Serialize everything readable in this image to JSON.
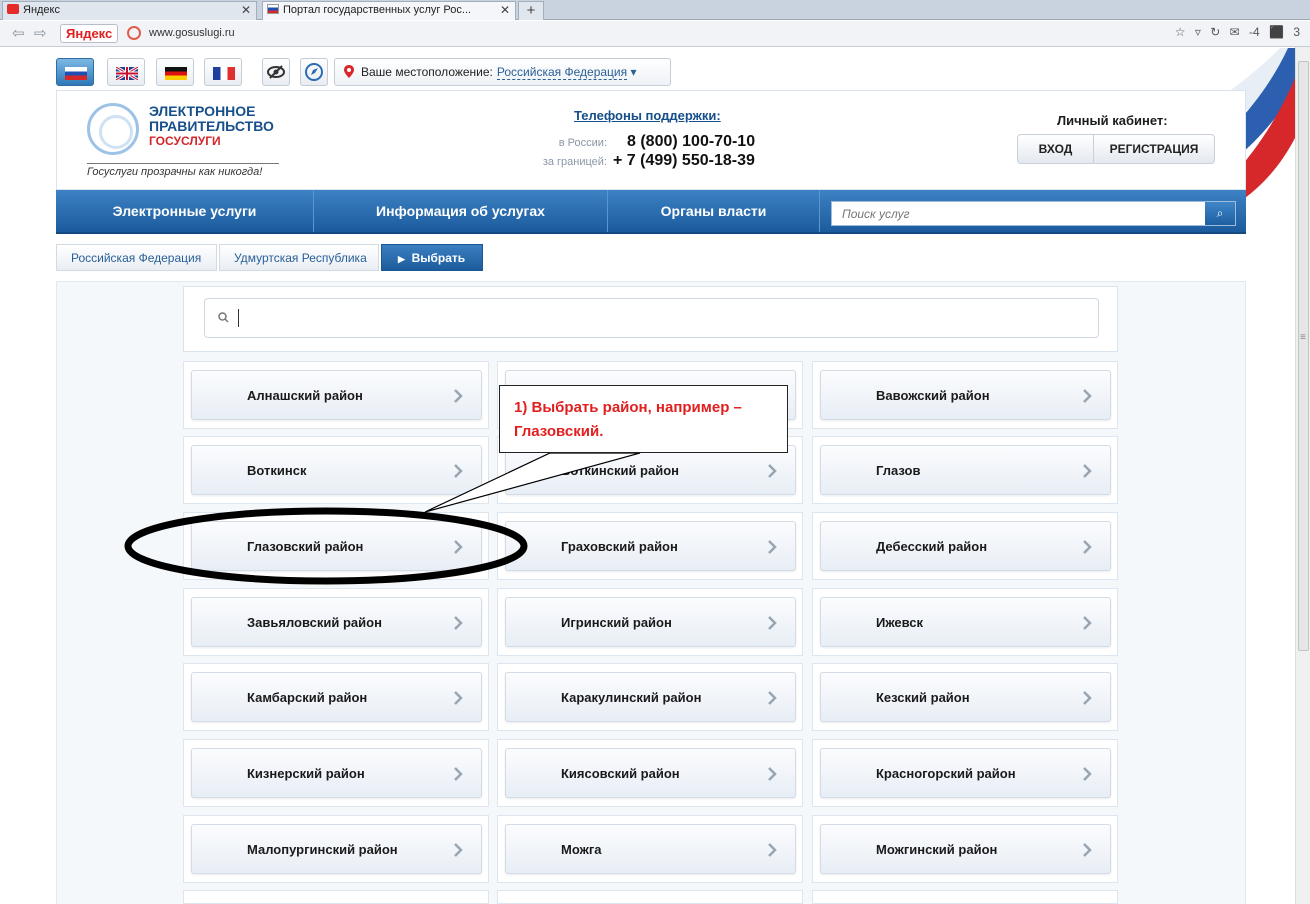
{
  "browser": {
    "tabs": [
      {
        "title": "Яндекс"
      },
      {
        "title": "Портал государственных услуг Рос..."
      }
    ],
    "brand_button": "Яндекс",
    "url": "www.gosuslugi.ru",
    "mail_count": "-4",
    "counter": "3"
  },
  "site": {
    "location_label": "Ваше местоположение:",
    "location_value": "Российская Федерация",
    "logo_line1": "ЭЛЕКТРОННОЕ",
    "logo_line2": "ПРАВИТЕЛЬСТВО",
    "logo_line3": "ГОСУСЛУГИ",
    "slogan": "Госуслуги прозрачны как никогда!",
    "phones_title": "Телефоны поддержки",
    "phone_ru_label": "в России:",
    "phone_ru": "8 (800) 100-70-10",
    "phone_abroad_label": "за границей:",
    "phone_abroad": "+ 7 (499) 550-18-39",
    "cabinet_title": "Личный кабинет:",
    "login": "ВХОД",
    "register": "РЕГИСТРАЦИЯ"
  },
  "nav": {
    "items": [
      "Электронные услуги",
      "Информация об услугах",
      "Органы власти"
    ],
    "search_placeholder": "Поиск услуг"
  },
  "breadcrumb": [
    "Российская Федерация",
    "Удмуртская Республика",
    "Выбрать"
  ],
  "districts": [
    [
      "Алнашский район",
      "",
      "Вавожский район"
    ],
    [
      "Воткинск",
      "Воткинский район",
      "Глазов"
    ],
    [
      "Глазовский район",
      "Граховский район",
      "Дебесский район"
    ],
    [
      "Завьяловский район",
      "Игринский район",
      "Ижевск"
    ],
    [
      "Камбарский район",
      "Каракулинский район",
      "Кезский район"
    ],
    [
      "Кизнерский район",
      "Киясовский район",
      "Красногорский район"
    ],
    [
      "Малопургинский район",
      "Можга",
      "Можгинский район"
    ]
  ],
  "annotation": {
    "text": "1) Выбрать район, например – Глазовский."
  },
  "colors": {
    "brand_blue": "#1b5b9d",
    "annotation_red": "#e21f1f"
  }
}
